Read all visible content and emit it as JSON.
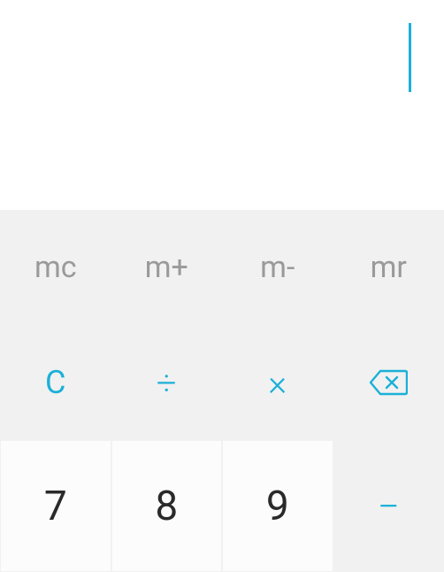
{
  "display": {
    "value": ""
  },
  "memory": {
    "mc": "mc",
    "mplus": "m+",
    "mminus": "m-",
    "mr": "mr"
  },
  "ops": {
    "clear": "C",
    "divide": "÷",
    "multiply": "×",
    "minus": "−"
  },
  "digits": {
    "d7": "7",
    "d8": "8",
    "d9": "9"
  },
  "colors": {
    "accent": "#1bb0d8",
    "keyBg": "#f1f1f1",
    "numBg": "#fcfcfc",
    "memText": "#9a9a9a",
    "digitText": "#2a2a2a"
  }
}
